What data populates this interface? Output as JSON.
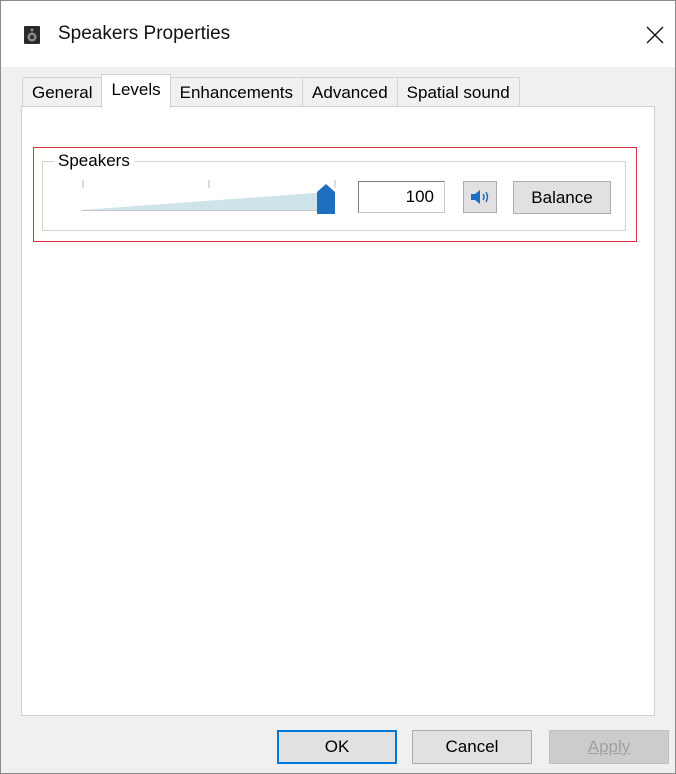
{
  "window": {
    "title": "Speakers Properties",
    "title_icon": "speaker-device-icon",
    "close_icon": "close-icon"
  },
  "tabs": [
    {
      "label": "General",
      "active": false
    },
    {
      "label": "Levels",
      "active": true
    },
    {
      "label": "Enhancements",
      "active": false
    },
    {
      "label": "Advanced",
      "active": false
    },
    {
      "label": "Spatial sound",
      "active": false
    }
  ],
  "levels": {
    "group_label": "Speakers",
    "slider_value": 100,
    "slider_max": 100,
    "level_text": "100",
    "mute_icon": "speaker-volume-icon",
    "balance_label": "Balance",
    "highlight_color": "#d9323e",
    "accent_color": "#1e6fc0"
  },
  "footer": {
    "ok_label": "OK",
    "cancel_label": "Cancel",
    "apply_label": "Apply",
    "apply_enabled": false
  }
}
